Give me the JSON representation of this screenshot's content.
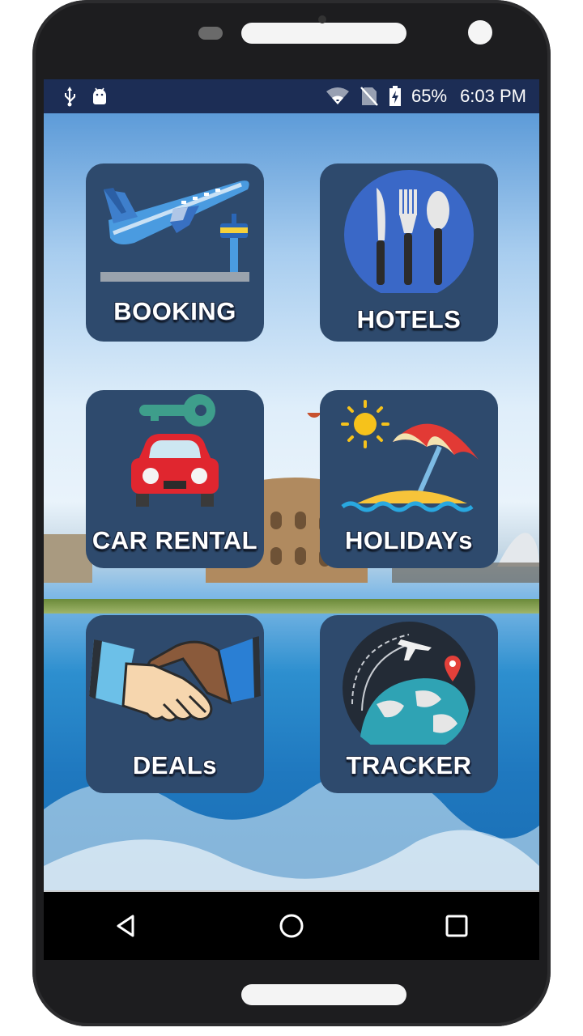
{
  "status_bar": {
    "icons_left": [
      "usb-icon",
      "android-debug-icon"
    ],
    "icons_right": [
      "wifi-icon",
      "no-sim-icon",
      "battery-charging-icon"
    ],
    "battery": "65%",
    "time": "6:03 PM"
  },
  "tiles": [
    {
      "label": "BOOKING",
      "icon": "airplane-takeoff-icon"
    },
    {
      "label": "HOTELS",
      "icon": "cutlery-icon"
    },
    {
      "label": "CAR RENTAL",
      "icon": "car-key-icon"
    },
    {
      "label": "HOLIDAYs",
      "icon": "beach-umbrella-icon"
    },
    {
      "label": "DEALs",
      "icon": "handshake-icon"
    },
    {
      "label": "TRACKER",
      "icon": "globe-flight-icon"
    }
  ],
  "nav": {
    "back": "back-icon",
    "home": "home-icon",
    "recents": "recents-icon"
  },
  "colors": {
    "tile_bg": "#2e4a6d",
    "status_bar_bg": "#1c2d55"
  }
}
